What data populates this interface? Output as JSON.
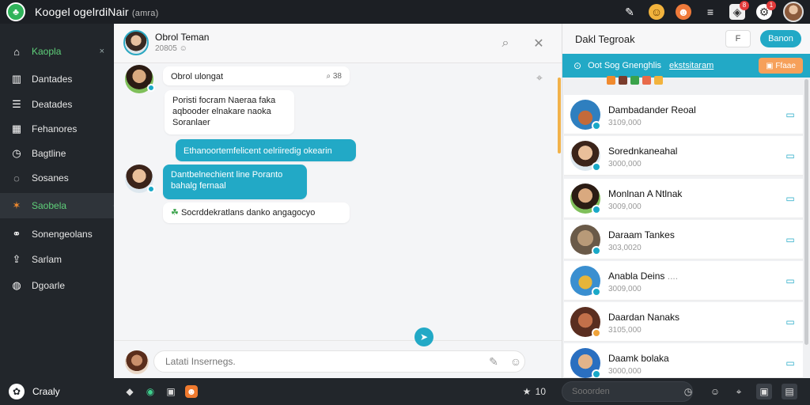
{
  "app": {
    "title": "Koogel ogelrdiNair",
    "logo_icon": "app-logo-icon",
    "title_suffix": "amra",
    "notifications": {
      "a": "8",
      "b": "1"
    }
  },
  "sidebar": {
    "items": [
      {
        "label": "Kaopla",
        "icon": "home-icon",
        "glyph": "⌂",
        "close": "×"
      },
      {
        "label": "Dantades",
        "icon": "chart-icon",
        "glyph": "▥"
      },
      {
        "label": "Deatades",
        "icon": "list-icon",
        "glyph": "☰"
      },
      {
        "label": "Fehanores",
        "icon": "calendar-icon",
        "glyph": "▦"
      },
      {
        "label": "Bagtline",
        "icon": "clock-icon",
        "glyph": "◷"
      },
      {
        "label": "Sosanes",
        "icon": "chat-icon",
        "glyph": "◌"
      },
      {
        "label": "Saobela",
        "icon": "star-icon",
        "glyph": "✶"
      },
      {
        "label": "Sonengeolans",
        "icon": "link-icon",
        "glyph": "⚭"
      },
      {
        "label": "Sarlam",
        "icon": "upload-icon",
        "glyph": "⇪"
      },
      {
        "label": "Dgoarle",
        "icon": "globe-icon",
        "glyph": "◍"
      }
    ],
    "bottom_label": "Craaly"
  },
  "chat": {
    "contact_name": "Obrol Teman",
    "contact_status": "20805",
    "messages": [
      {
        "text": "Obrol ulongat",
        "meta": "38"
      },
      {
        "line1": "Poristi focram Naeraa faka",
        "line2": "aqbooder elnakare naoka",
        "line3": "Soranlaer"
      },
      {
        "text": "Ethanoortemfelicent oelriiredig okearin"
      },
      {
        "line1": "Dantbelnechient line Poranto",
        "line2": "bahalg fernaal"
      },
      {
        "text": "Socrddekratlans danko angagocyo"
      }
    ],
    "composer_placeholder": "Latati Insernegs."
  },
  "statusbar": {
    "count": "10"
  },
  "contacts": {
    "title": "Dakl Tegroak",
    "small_button": "F",
    "primary_button": "Banon",
    "banner_text": "Oot Sog Gnenghlis",
    "banner_link": "ekstsitaram",
    "banner_button": "Ffaae",
    "list": [
      {
        "name": "Dambadander Reoal",
        "sub": "3109,000",
        "status": "blue"
      },
      {
        "name": "Sorednkaneahal",
        "sub": "3000,000",
        "status": "blue"
      },
      {
        "name": "Monlnan A Ntlnak",
        "sub": "3009,000",
        "status": "blue"
      },
      {
        "name": "Daraam Tankes",
        "sub": "303,0020",
        "status": "blue"
      },
      {
        "name": "Anabla Deins",
        "sub": "3009,000",
        "status": "blue"
      },
      {
        "name": "Daardan Nanaks",
        "sub": "3105,000",
        "status": "orange"
      },
      {
        "name": "Daamk bolaka",
        "sub": "3000,000",
        "status": "blue"
      }
    ],
    "search_placeholder": "Sooorden"
  },
  "colors": {
    "accent": "#22a9c6",
    "sidebar_bg": "#22262b",
    "active_label": "#5fd07a"
  }
}
